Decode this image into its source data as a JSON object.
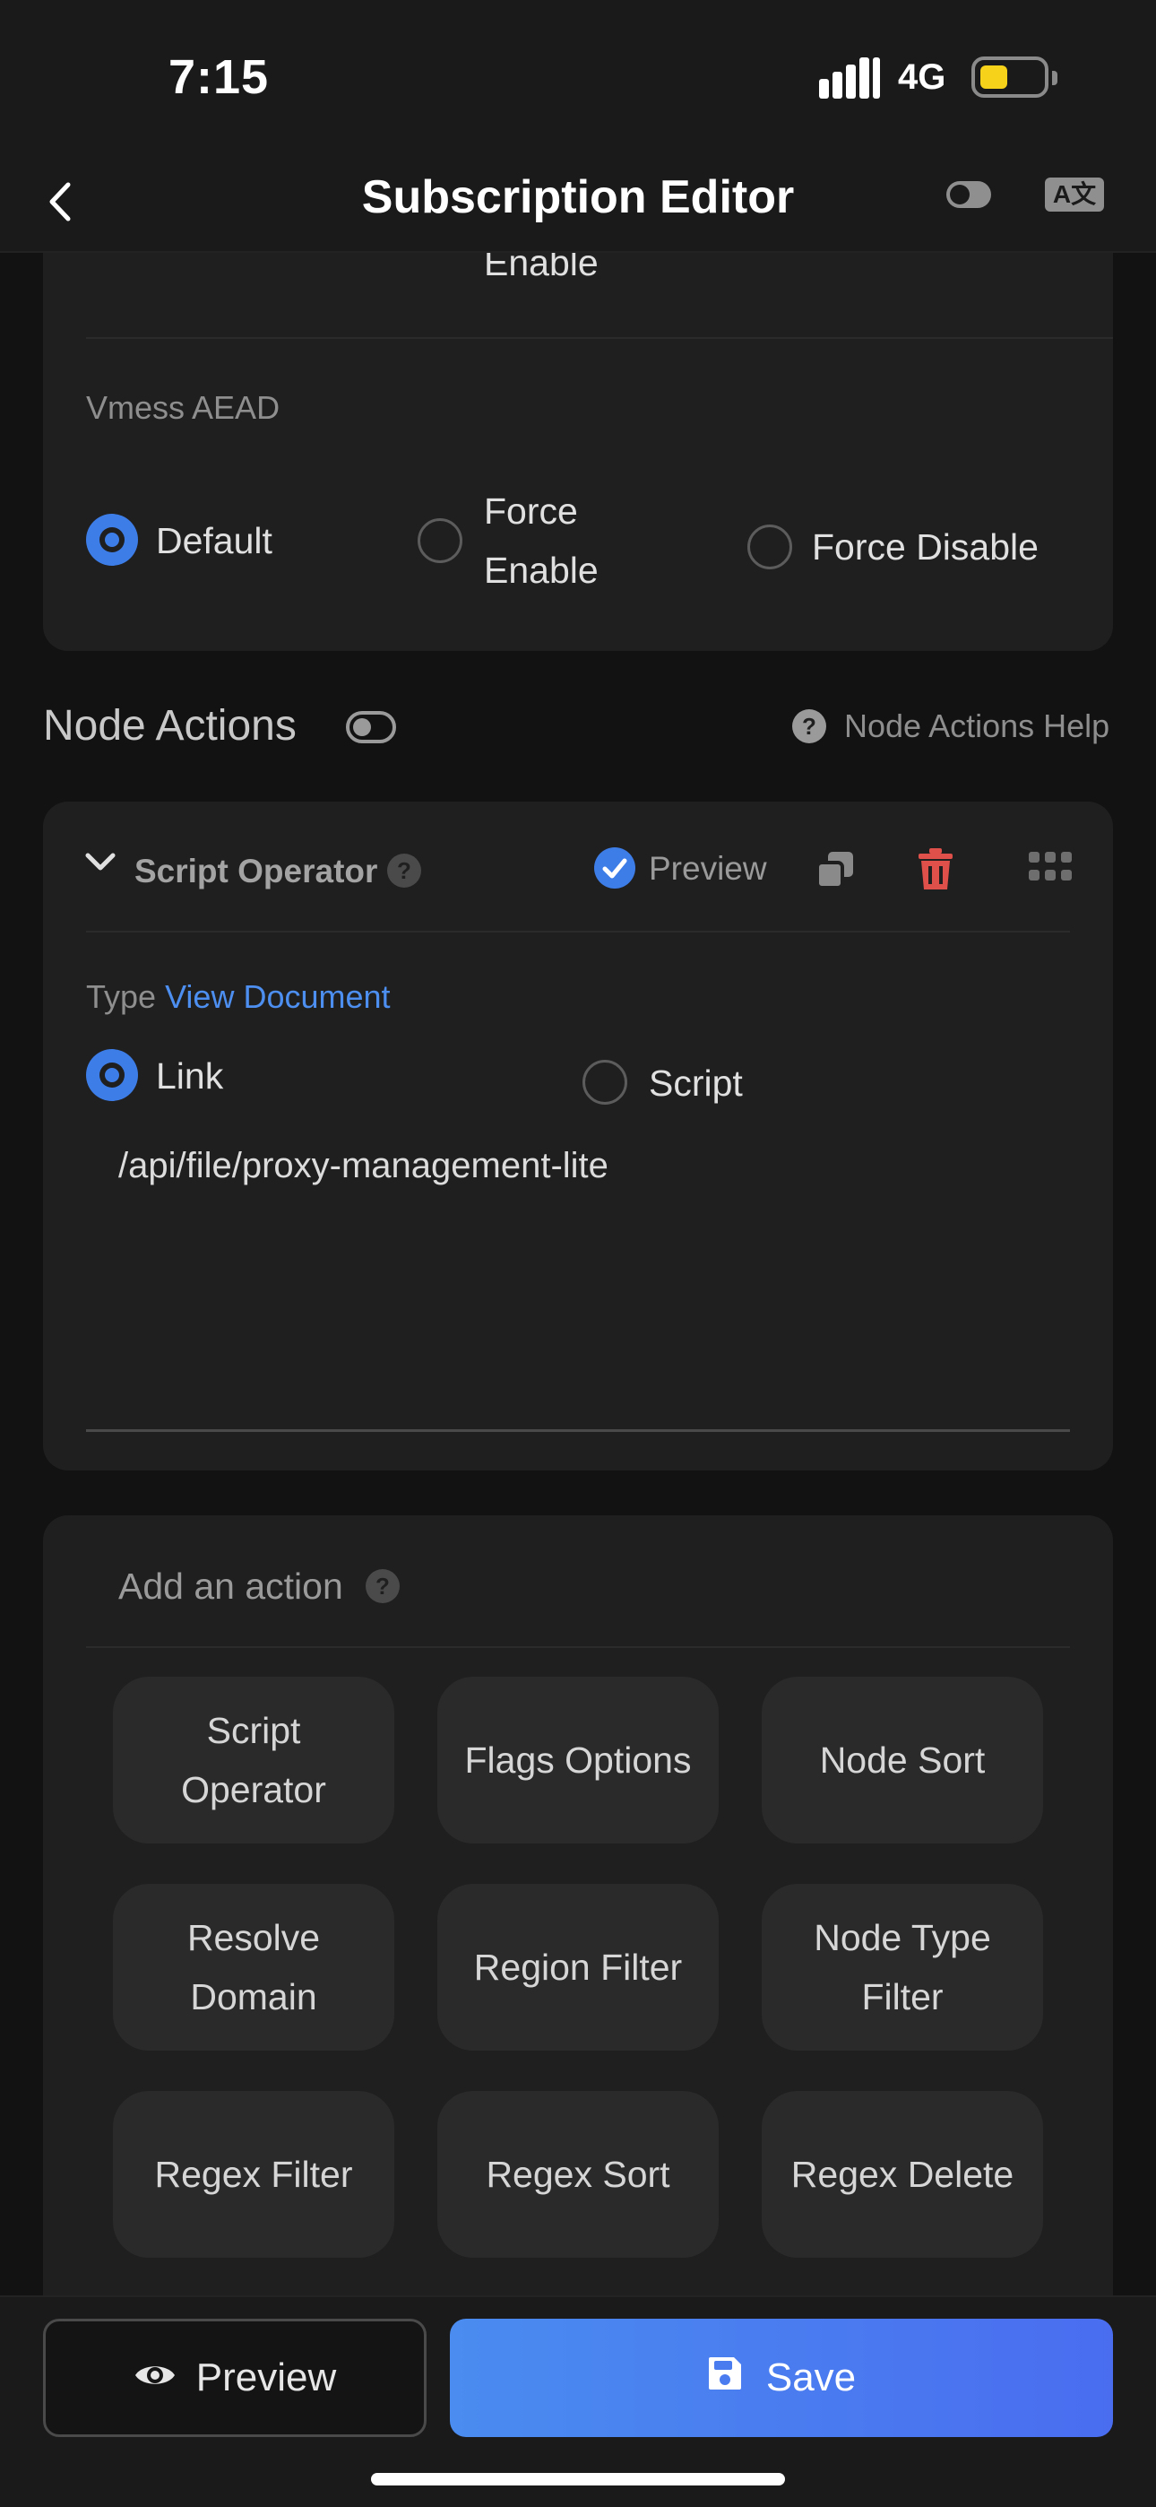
{
  "status": {
    "time": "7:15",
    "network": "4G"
  },
  "header": {
    "title": "Subscription Editor"
  },
  "top_card": {
    "partial_option": "Enable",
    "vmess": {
      "label": "Vmess AEAD",
      "options": [
        "Default",
        "Force\nEnable",
        "Force Disable"
      ],
      "selected": "Default"
    }
  },
  "node_actions": {
    "title": "Node Actions",
    "help_label": "Node Actions Help"
  },
  "script_operator": {
    "title": "Script Operator",
    "preview_label": "Preview",
    "type_label": "Type",
    "view_doc_label": "View Document",
    "options": [
      "Link",
      "Script"
    ],
    "selected": "Link",
    "value": "/api/file/proxy-management-lite"
  },
  "add_action": {
    "title": "Add an action",
    "buttons": [
      "Script Operator",
      "Flags Options",
      "Node Sort",
      "Resolve Domain",
      "Region Filter",
      "Node Type Filter",
      "Regex Filter",
      "Regex Sort",
      "Regex Delete"
    ]
  },
  "bottom": {
    "preview_label": "Preview",
    "save_label": "Save"
  },
  "colors": {
    "accent": "#3d7de8",
    "danger": "#e0504a",
    "background": "#121212",
    "card": "#1f1f1f"
  },
  "icons": [
    "back-chevron-icon",
    "toggle-icon",
    "translate-icon",
    "help-icon",
    "chevron-down-icon",
    "check-circle-icon",
    "copy-icon",
    "trash-icon",
    "drag-grid-icon",
    "eye-icon",
    "floppy-disk-icon"
  ]
}
